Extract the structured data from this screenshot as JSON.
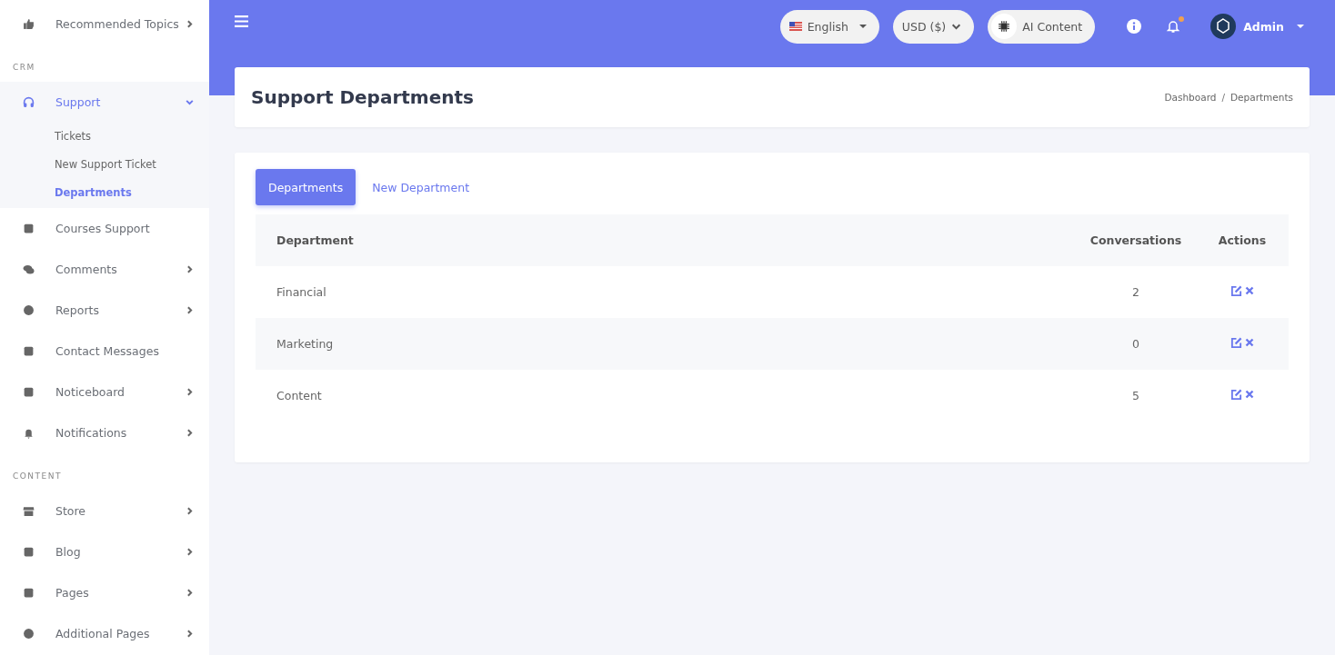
{
  "sidebar": {
    "sections": [
      {
        "items": [
          {
            "label": "Recommended Topics",
            "kind": "menu",
            "expanded": false,
            "selected": false
          }
        ]
      },
      {
        "header": "CRM",
        "items": [
          {
            "label": "Support",
            "kind": "menu",
            "expanded": true,
            "selected": true,
            "children": [
              {
                "label": "Tickets",
                "selected": false
              },
              {
                "label": "New Support Ticket",
                "selected": false
              },
              {
                "label": "Departments",
                "selected": true
              }
            ]
          },
          {
            "label": "Courses Support",
            "kind": "link",
            "selected": false
          },
          {
            "label": "Comments",
            "kind": "menu",
            "expanded": false,
            "selected": false
          },
          {
            "label": "Reports",
            "kind": "menu",
            "expanded": false,
            "selected": false
          },
          {
            "label": "Contact Messages",
            "kind": "link",
            "selected": false
          },
          {
            "label": "Noticeboard",
            "kind": "menu",
            "expanded": false,
            "selected": false
          },
          {
            "label": "Notifications",
            "kind": "menu",
            "expanded": false,
            "selected": false
          }
        ]
      },
      {
        "header": "CONTENT",
        "items": [
          {
            "label": "Store",
            "kind": "menu",
            "expanded": false,
            "selected": false
          },
          {
            "label": "Blog",
            "kind": "menu",
            "expanded": false,
            "selected": false
          },
          {
            "label": "Pages",
            "kind": "menu",
            "expanded": false,
            "selected": false
          },
          {
            "label": "Additional Pages",
            "kind": "menu",
            "expanded": false,
            "selected": false
          }
        ]
      }
    ]
  },
  "topbar": {
    "language": "English",
    "currency": "USD ($)",
    "ai_button": "AI Content",
    "notifications_unread": true,
    "user": "Admin"
  },
  "page_header": {
    "title": "Support Departments",
    "breadcrumb": [
      {
        "label": "Dashboard",
        "kind": "link"
      },
      {
        "label": "/",
        "kind": "separator"
      },
      {
        "label": "Departments",
        "kind": "current"
      }
    ]
  },
  "tabs": [
    {
      "label": "Departments",
      "selected": true
    },
    {
      "label": "New Department",
      "selected": false
    }
  ],
  "table": {
    "columns": [
      "Department",
      "Conversations",
      "Actions"
    ],
    "rows": [
      {
        "department": "Financial",
        "conversations": "2"
      },
      {
        "department": "Marketing",
        "conversations": "0"
      },
      {
        "department": "Content",
        "conversations": "5"
      }
    ]
  }
}
